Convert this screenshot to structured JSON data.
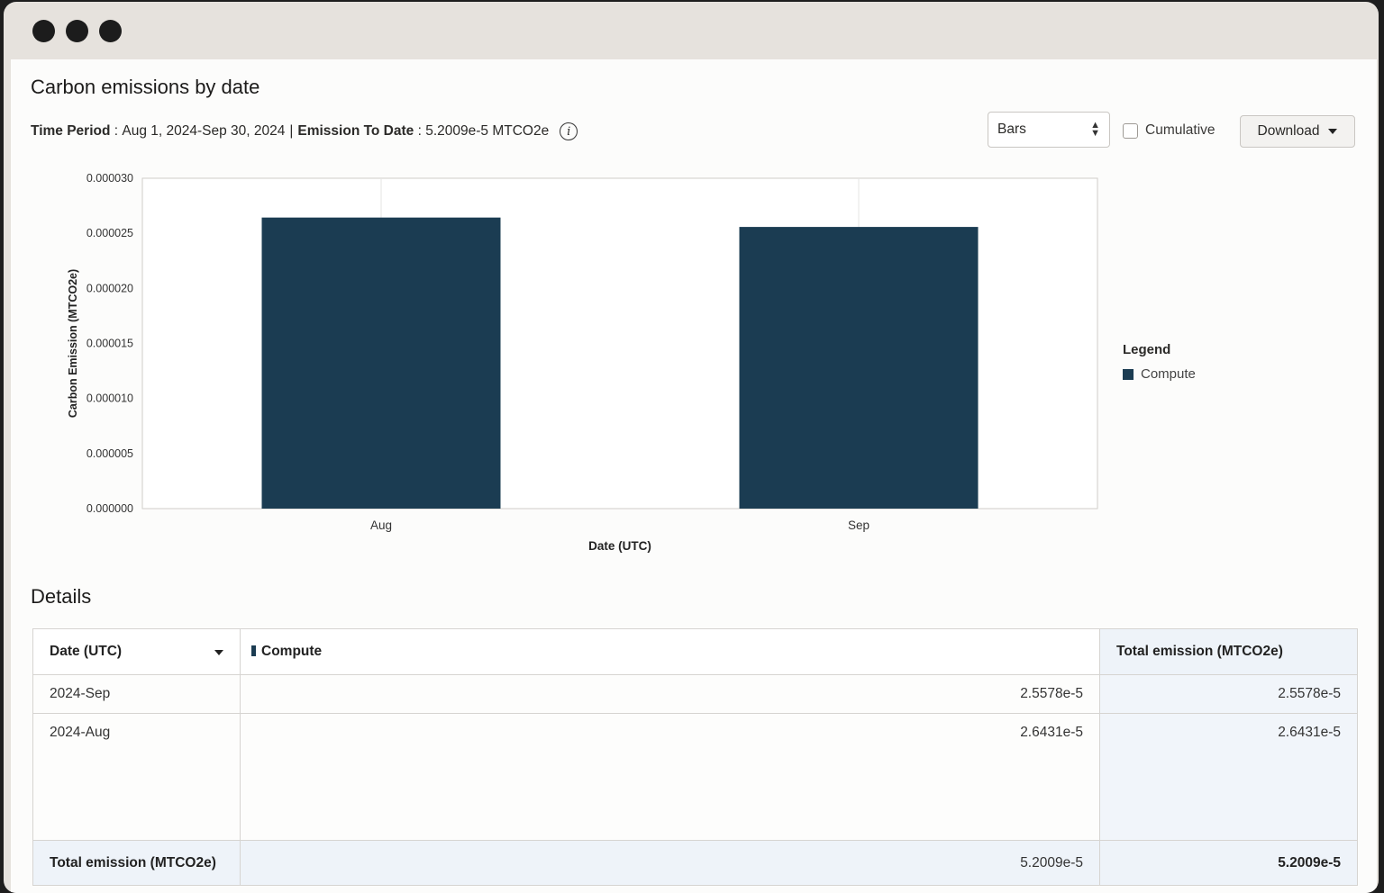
{
  "window": {
    "controls": [
      "close",
      "minimize",
      "maximize"
    ]
  },
  "page": {
    "title": "Carbon emissions by date"
  },
  "meta": {
    "time_period_label": "Time Period",
    "time_period_value": "Aug 1, 2024-Sep 30, 2024",
    "separator": "|",
    "emission_label": "Emission To Date",
    "emission_value": "5.2009e-5 MTCO2e",
    "colon": " : "
  },
  "controls": {
    "chart_type": "Bars",
    "cumulative_label": "Cumulative",
    "cumulative_checked": false,
    "download_label": "Download"
  },
  "chart_data": {
    "type": "bar",
    "categories": [
      "Aug",
      "Sep"
    ],
    "series": [
      {
        "name": "Compute",
        "values": [
          2.6431e-05,
          2.5578e-05
        ],
        "color": "#1b3c52"
      }
    ],
    "xlabel": "Date (UTC)",
    "ylabel": "Carbon Emission (MTCO2e)",
    "ylim": [
      0,
      3e-05
    ],
    "yticks": [
      "0.000000",
      "0.000005",
      "0.000010",
      "0.000015",
      "0.000020",
      "0.000025",
      "0.000030"
    ],
    "legend": {
      "title": "Legend",
      "position": "right"
    }
  },
  "details": {
    "title": "Details",
    "columns": [
      "Date (UTC)",
      "Compute",
      "Total emission (MTCO2e)"
    ],
    "rows": [
      {
        "date": "2024-Sep",
        "compute": "2.5578e-5",
        "total": "2.5578e-5"
      },
      {
        "date": "2024-Aug",
        "compute": "2.6431e-5",
        "total": "2.6431e-5"
      }
    ],
    "footer": {
      "label": "Total emission (MTCO2e)",
      "compute": "5.2009e-5",
      "total": "5.2009e-5"
    }
  }
}
